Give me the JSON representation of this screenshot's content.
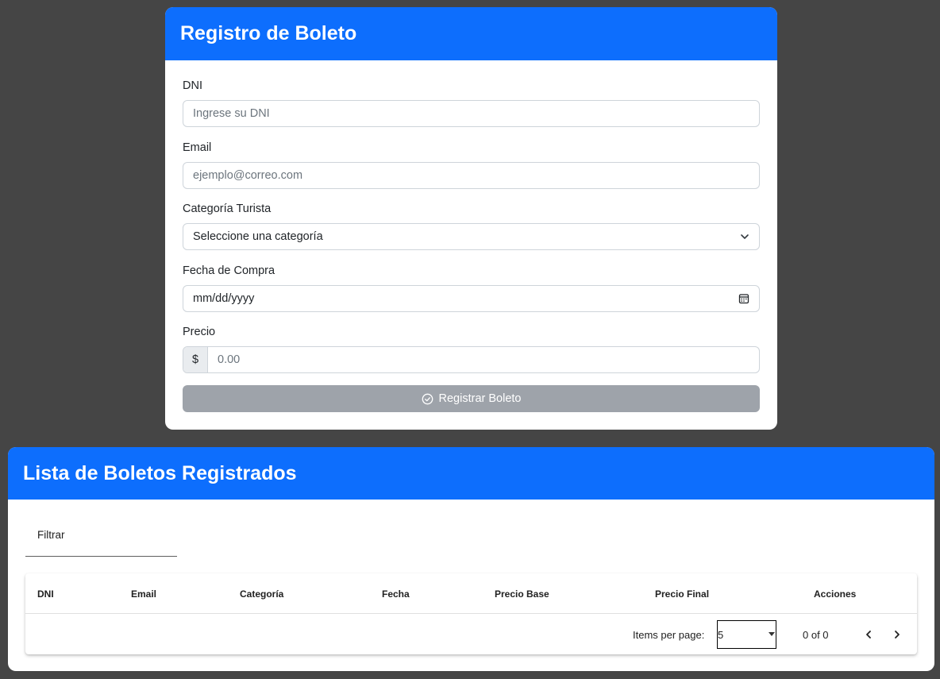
{
  "registration": {
    "title": "Registro de Boleto",
    "dni": {
      "label": "DNI",
      "placeholder": "Ingrese su DNI"
    },
    "email": {
      "label": "Email",
      "placeholder": "ejemplo@correo.com"
    },
    "category": {
      "label": "Categoría Turista",
      "selected": "Seleccione una categoría"
    },
    "date": {
      "label": "Fecha de Compra",
      "value": "mm/dd/yyyy"
    },
    "price": {
      "label": "Precio",
      "currency": "$",
      "placeholder": "0.00"
    },
    "submit_label": "Registrar Boleto"
  },
  "list": {
    "title": "Lista de Boletos Registrados",
    "filter_label": "Filtrar",
    "columns": [
      "DNI",
      "Email",
      "Categoría",
      "Fecha",
      "Precio Base",
      "Precio Final",
      "Acciones"
    ],
    "rows": [],
    "paginator": {
      "items_per_page_label": "Items per page:",
      "page_size": "5",
      "range_label": "0 of 0"
    }
  },
  "colors": {
    "primary": "#0d6efd",
    "background": "#454545",
    "disabled_button": "#9ea3aa"
  },
  "icons": {
    "select_caret": "chevron-down-icon",
    "date_picker": "calendar-icon",
    "submit": "check-circle-icon",
    "prev_page": "chevron-left-icon",
    "next_page": "chevron-right-icon"
  }
}
